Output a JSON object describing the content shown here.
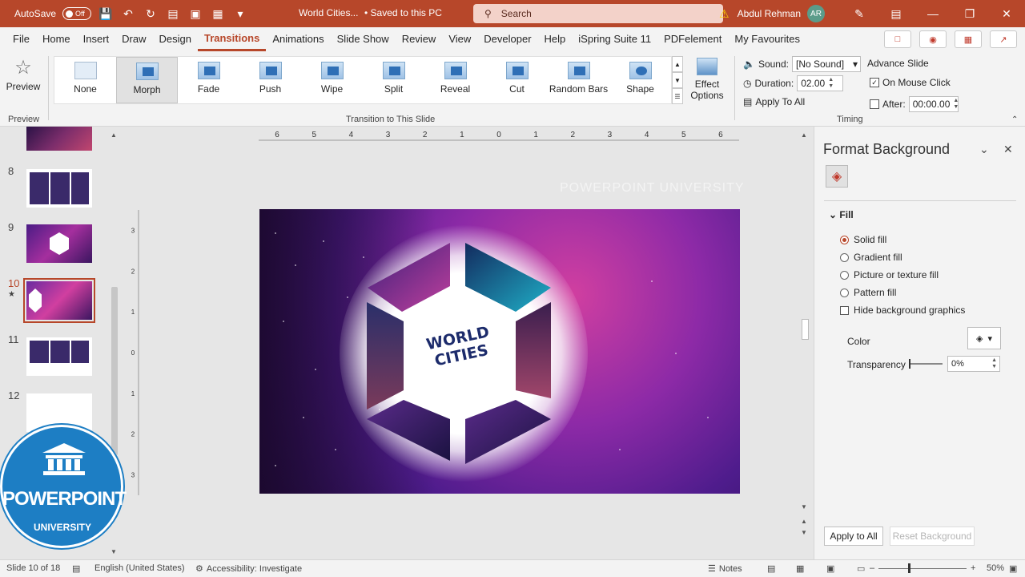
{
  "titlebar": {
    "autosave_label": "AutoSave",
    "autosave_state": "Off",
    "doc_title": "World Cities...",
    "saved_status": "• Saved to this PC",
    "search_placeholder": "Search",
    "user_name": "Abdul Rehman",
    "user_initials": "AR"
  },
  "menu": {
    "tabs": [
      "File",
      "Home",
      "Insert",
      "Draw",
      "Design",
      "Transitions",
      "Animations",
      "Slide Show",
      "Review",
      "View",
      "Developer",
      "Help",
      "iSpring Suite 11",
      "PDFelement",
      "My Favourites"
    ],
    "active_tab": "Transitions"
  },
  "ribbon": {
    "preview_label": "Preview",
    "preview_group": "Preview",
    "transitions": [
      "None",
      "Morph",
      "Fade",
      "Push",
      "Wipe",
      "Split",
      "Reveal",
      "Cut",
      "Random Bars",
      "Shape"
    ],
    "selected_transition": "Morph",
    "transition_group": "Transition to This Slide",
    "effect_options_line1": "Effect",
    "effect_options_line2": "Options",
    "sound_label": "Sound:",
    "sound_value": "[No Sound]",
    "duration_label": "Duration:",
    "duration_value": "02.00",
    "apply_all_label": "Apply To All",
    "advance_label": "Advance Slide",
    "on_click_label": "On Mouse Click",
    "on_click_checked": true,
    "after_label": "After:",
    "after_value": "00:00.00",
    "after_checked": false,
    "timing_group": "Timing"
  },
  "slides": {
    "numbers": [
      "8",
      "9",
      "10",
      "11",
      "12"
    ],
    "selected": "10"
  },
  "slide": {
    "title_line1": "WORLD",
    "title_line2": "CITIES",
    "watermark": "POWERPOINT UNIVERSITY"
  },
  "ruler": {
    "top_marks": [
      "6",
      "5",
      "4",
      "3",
      "2",
      "1",
      "0",
      "1",
      "2",
      "3",
      "4",
      "5",
      "6"
    ],
    "left_marks": [
      "3",
      "2",
      "1",
      "0",
      "1",
      "2",
      "3"
    ]
  },
  "format_pane": {
    "title": "Format Background",
    "fill_header": "Fill",
    "options": [
      "Solid fill",
      "Gradient fill",
      "Picture or texture fill",
      "Pattern fill"
    ],
    "selected_option": "Solid fill",
    "hide_bg_label": "Hide background graphics",
    "color_label": "Color",
    "transparency_label": "Transparency",
    "transparency_value": "0%",
    "apply_all_btn": "Apply to All",
    "reset_btn": "Reset Background"
  },
  "statusbar": {
    "slide_info": "Slide 10 of 18",
    "language": "English (United States)",
    "accessibility": "Accessibility: Investigate",
    "notes_label": "Notes",
    "zoom": "50%"
  },
  "logo": {
    "word": "POWERPOINT",
    "sub": "UNIVERSITY"
  },
  "colors": {
    "accent": "#b7472a",
    "logo_blue": "#1d7ec4"
  }
}
